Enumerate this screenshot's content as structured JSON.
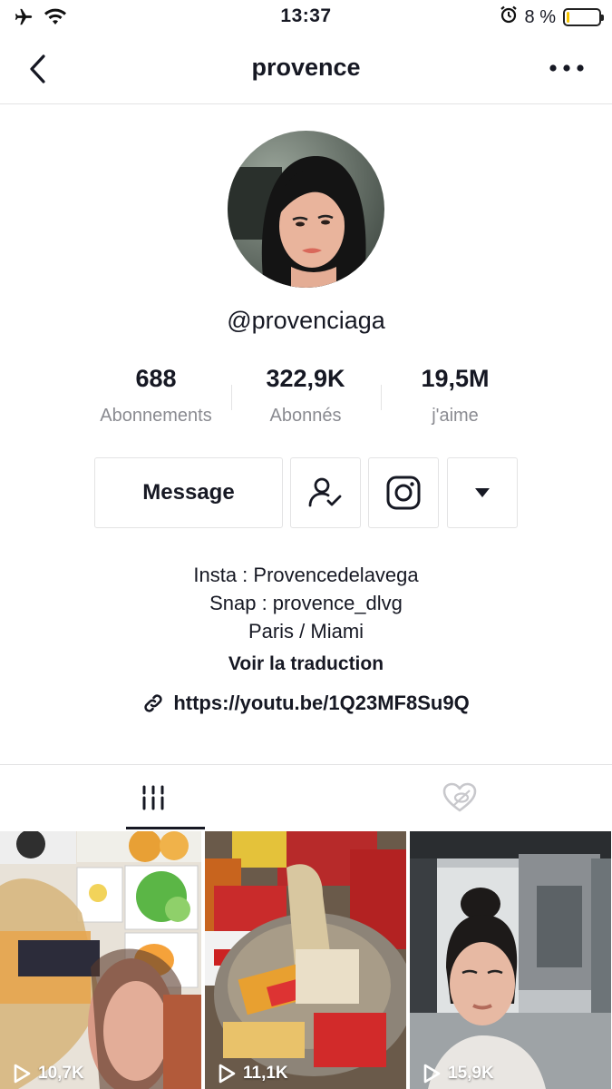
{
  "status_bar": {
    "time": "13:37",
    "battery_text": "8 %",
    "battery_level": 0.08,
    "icons": [
      "airplane-icon",
      "wifi-icon",
      "alarm-icon",
      "battery-icon"
    ]
  },
  "nav": {
    "title": "provence",
    "icons": [
      "back-chevron-icon",
      "more-dots-icon"
    ]
  },
  "profile": {
    "username": "@provenciaga",
    "stats": [
      {
        "value": "688",
        "label": "Abonnements"
      },
      {
        "value": "322,9K",
        "label": "Abonnés"
      },
      {
        "value": "19,5M",
        "label": "j'aime"
      }
    ]
  },
  "actions": {
    "message_label": "Message",
    "icons": [
      "following-check-icon",
      "instagram-icon",
      "dropdown-arrow-icon"
    ]
  },
  "bio": {
    "lines": [
      "Insta : Provencedelavega",
      "Snap : provence_dlvg",
      "Paris / Miami"
    ],
    "translate_label": "Voir la traduction",
    "link": "https://youtu.be/1Q23MF8Su9Q"
  },
  "tabs": {
    "icons": [
      "videos-grid-icon",
      "liked-hidden-icon"
    ],
    "active_index": 0
  },
  "videos": [
    {
      "views": "10,7K"
    },
    {
      "views": "11,1K"
    },
    {
      "views": "15,9K"
    }
  ],
  "colors": {
    "text": "#161823",
    "muted": "#8a8b91",
    "border": "#e3e3e4",
    "battery_low": "#f5c400"
  }
}
